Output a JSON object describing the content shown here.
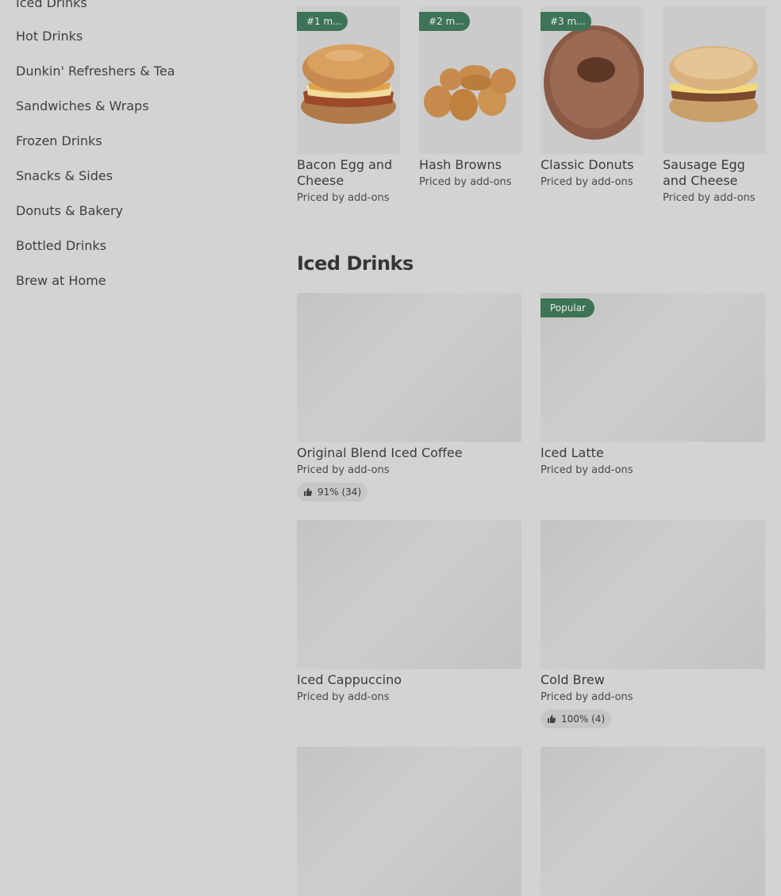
{
  "sidebar": {
    "items": [
      {
        "label": "Iced Drinks"
      },
      {
        "label": "Hot Drinks"
      },
      {
        "label": "Dunkin' Refreshers & Tea"
      },
      {
        "label": "Sandwiches & Wraps"
      },
      {
        "label": "Frozen Drinks"
      },
      {
        "label": "Snacks & Sides"
      },
      {
        "label": "Donuts & Bakery"
      },
      {
        "label": "Bottled Drinks"
      },
      {
        "label": "Brew at Home"
      }
    ]
  },
  "top_items": [
    {
      "badge": "#1 m...",
      "name": "Bacon Egg and Cheese",
      "price": "Priced by add-ons",
      "icon": "bagel-sandwich-image"
    },
    {
      "badge": "#2 m...",
      "name": "Hash Browns",
      "price": "Priced by add-ons",
      "icon": "hash-browns-image"
    },
    {
      "badge": "#3 m...",
      "name": "Classic Donuts",
      "price": "Priced by add-ons",
      "icon": "donut-image"
    },
    {
      "badge": "",
      "name": "Sausage Egg and Cheese",
      "price": "Priced by add-ons",
      "icon": "english-muffin-sandwich-image"
    }
  ],
  "section": {
    "title": "Iced Drinks",
    "items": [
      {
        "name": "Original Blend Iced Coffee",
        "price": "Priced by add-ons",
        "rating": "91% (34)"
      },
      {
        "name": "Iced Latte",
        "price": "Priced by add-ons",
        "badge": "Popular"
      },
      {
        "name": "Iced Cappuccino",
        "price": "Priced by add-ons"
      },
      {
        "name": "Cold Brew",
        "price": "Priced by add-ons",
        "rating": "100% (4)"
      }
    ]
  },
  "colors": {
    "background": "#d3d3d3",
    "badge_green": "#3d7356",
    "placeholder": "#c6c6c6",
    "text": "#3c3c3c"
  }
}
